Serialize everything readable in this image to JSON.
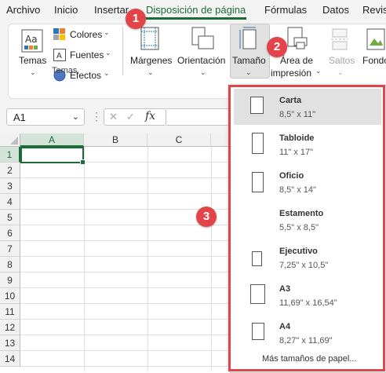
{
  "tabs": [
    "Archivo",
    "Inicio",
    "Insertar",
    "Disposición de página",
    "Fórmulas",
    "Datos",
    "Revis"
  ],
  "ribbon": {
    "temas_label": "Temas",
    "colores_label": "Colores",
    "fuentes_label": "Fuentes",
    "efectos_label": "Efectos",
    "group_temas": "Temas",
    "margenes_label": "Márgenes",
    "orientacion_label": "Orientación",
    "tamano_label": "Tamaño",
    "area_label_1": "Área de",
    "area_label_2": "impresión",
    "saltos_label": "Saltos",
    "fondo_label": "Fondo"
  },
  "formula_bar": {
    "name_box": "A1",
    "fx": "fx",
    "cancel": "✕",
    "confirm": "✓"
  },
  "grid": {
    "columns": [
      "A",
      "B",
      "C"
    ],
    "rows": [
      "1",
      "2",
      "3",
      "4",
      "5",
      "6",
      "7",
      "8",
      "9",
      "10",
      "11",
      "12",
      "13",
      "14"
    ]
  },
  "size_menu": {
    "items": [
      {
        "name": "Carta",
        "size": "8,5\" x 11\""
      },
      {
        "name": "Tabloide",
        "size": "11\" x 17\""
      },
      {
        "name": "Oficio",
        "size": "8,5\" x 14\""
      },
      {
        "name": "Estamento",
        "size": "5,5\" x 8,5\""
      },
      {
        "name": "Ejecutivo",
        "size": "7,25\" x 10,5\""
      },
      {
        "name": "A3",
        "size": "11,69\" x 16,54\""
      },
      {
        "name": "A4",
        "size": "8,27\" x 11,69\""
      }
    ],
    "more": "Más tamaños de papel..."
  },
  "annotations": [
    "1",
    "2",
    "3"
  ],
  "colors": {
    "accent": "#1e6b3a",
    "annotation": "#e2444a"
  }
}
